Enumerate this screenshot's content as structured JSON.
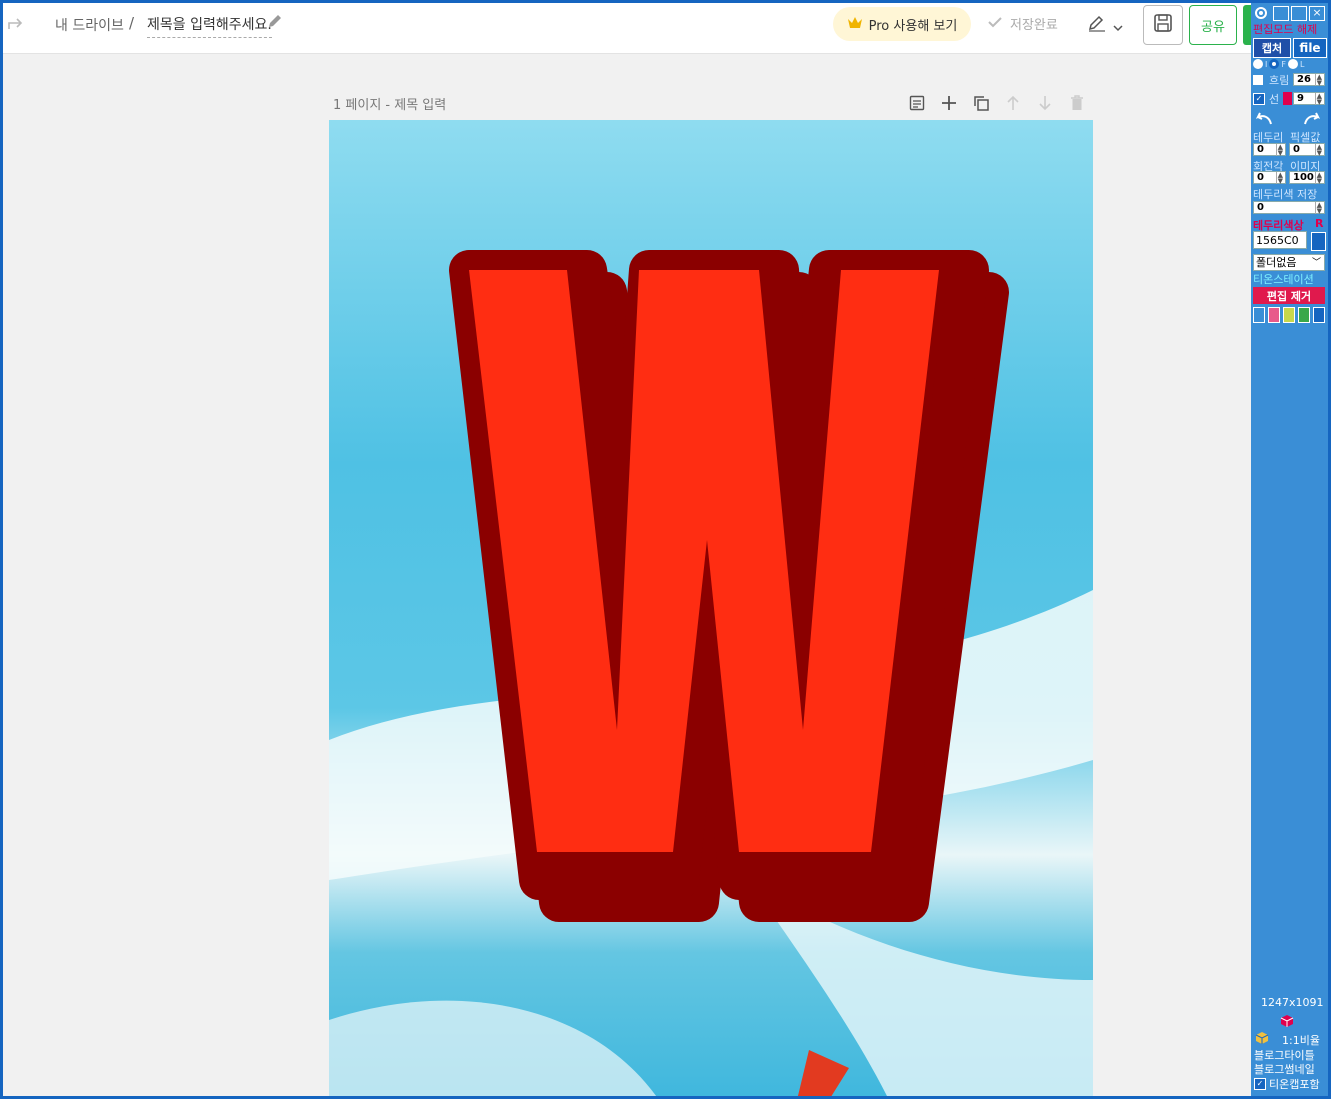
{
  "header": {
    "breadcrumb_root": "내 드라이브",
    "breadcrumb_sep": "/",
    "title_placeholder": "제목을 입력해주세요.",
    "pro_button": "Pro 사용해 보기",
    "save_status": "저장완료",
    "share_button": "공유"
  },
  "page": {
    "label": "1 페이지 - 제목 입력",
    "letter": "W"
  },
  "sidebar": {
    "edit_mode_off": "편집모드 해제",
    "capture": "캡처",
    "file": "file",
    "radio_labels": [
      "I",
      "F",
      "L"
    ],
    "blur_label": "흐림",
    "blur_value": "26",
    "line_label": "선",
    "line_value": "9",
    "border_label": "테두리",
    "pixel_label": "픽셀값",
    "border_value": "0",
    "pixel_value": "0",
    "rotate_label": "회전각",
    "image_label": "이미지",
    "rotate_value": "0",
    "image_value": "100",
    "border_color_save_label": "테두리색 저장",
    "border_color_save_value": "0",
    "border_color_label": "테두리색상",
    "border_color_flag": "R",
    "border_color_hex": "1565C0",
    "folder_select": "폴더없음",
    "station_link": "티온스테이션",
    "remove_edit": "편집 제거",
    "swatches": [
      "#3a8ed6",
      "#e85a8a",
      "#c8d84a",
      "#3aa84a",
      "#1565c0"
    ],
    "dimensions": "1247x1091",
    "ratio_label": "1:1비율",
    "blog_title": "블로그타이틀",
    "blog_thumb": "블로그썸네일",
    "include_label": "티온캡포함"
  },
  "colors": {
    "accent_green": "#2bb24c",
    "letter_fill": "#ff2d12",
    "letter_outline": "#8b0000",
    "sidebar_bg": "#3a8ed6"
  }
}
